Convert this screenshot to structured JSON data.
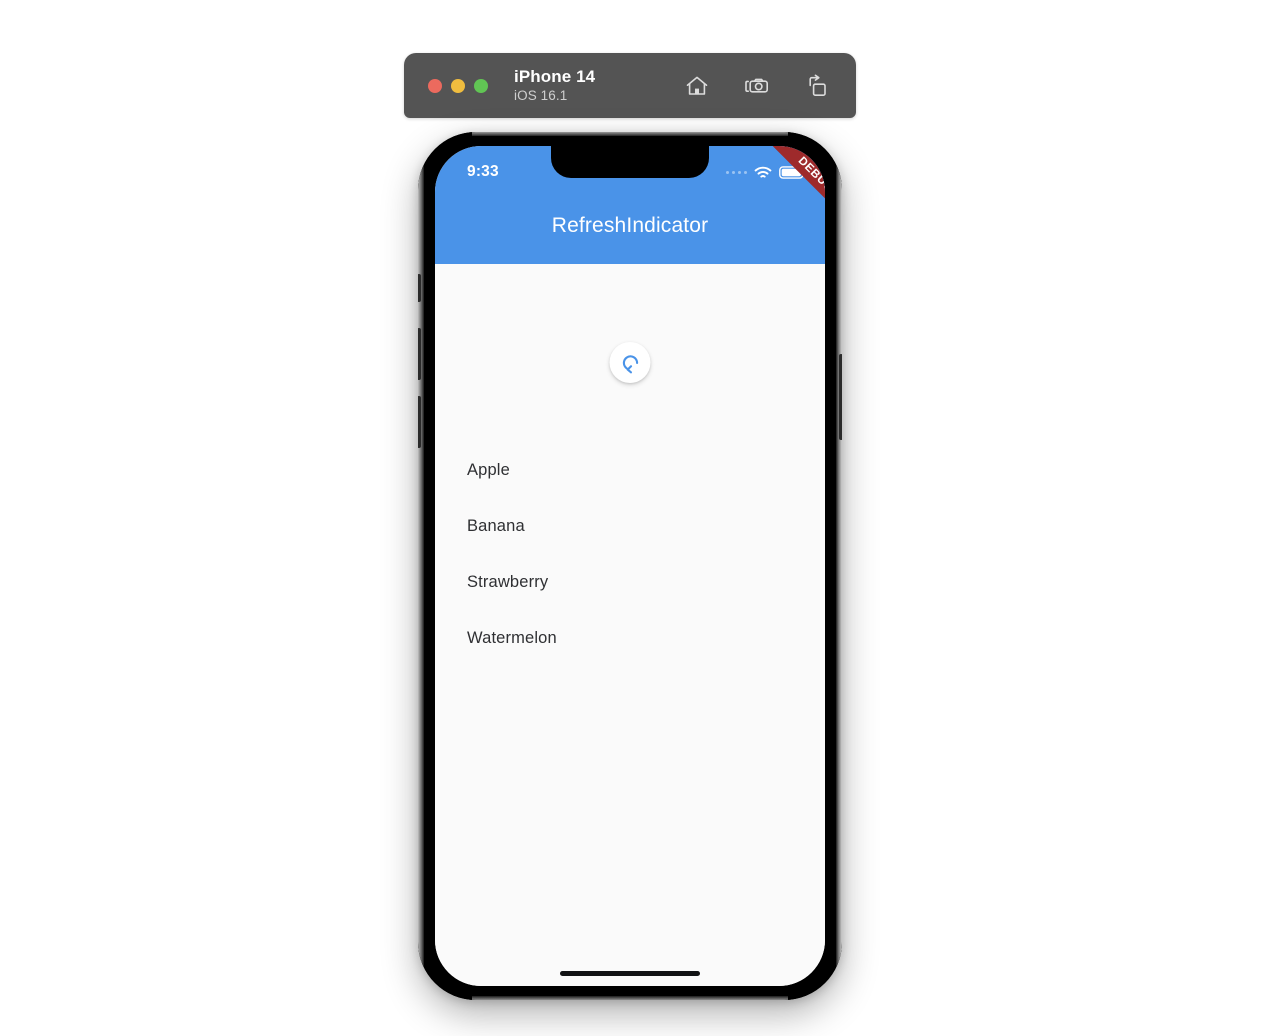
{
  "simulator": {
    "window_controls": [
      {
        "name": "close",
        "color": "#ec6a5e"
      },
      {
        "name": "minimize",
        "color": "#f0bd3f"
      },
      {
        "name": "zoom",
        "color": "#61c554"
      }
    ],
    "device_name": "iPhone 14",
    "os_version": "iOS 16.1",
    "toolbar_icons": [
      {
        "name": "home-icon",
        "label": "Home"
      },
      {
        "name": "screenshot-camera-icon",
        "label": "Screenshot"
      },
      {
        "name": "rotate-icon",
        "label": "Rotate"
      }
    ],
    "titlebar_color": "#545454"
  },
  "device": {
    "frame_color": "#000000",
    "screen_background": "#fafafa"
  },
  "status_bar": {
    "time": "9:33",
    "signal_icon": "cellular-signal-icon",
    "wifi_icon": "wifi-icon",
    "battery_icon": "battery-icon",
    "text_color": "#ffffff"
  },
  "debug_banner": {
    "label": "DEBUG",
    "color": "#9e2a2b",
    "text_color": "#ffffff"
  },
  "app_bar": {
    "title": "RefreshIndicator",
    "background_color": "#4a93e8",
    "title_color": "#ffffff"
  },
  "refresh_indicator": {
    "icon": "refresh-circular-arrow-icon",
    "icon_color": "#4a93e8",
    "card_color": "#ffffff"
  },
  "list": {
    "items": [
      {
        "label": "Apple"
      },
      {
        "label": "Banana"
      },
      {
        "label": "Strawberry"
      },
      {
        "label": "Watermelon"
      }
    ],
    "text_color": "#2f3033"
  },
  "home_indicator": {
    "color": "#111214"
  }
}
